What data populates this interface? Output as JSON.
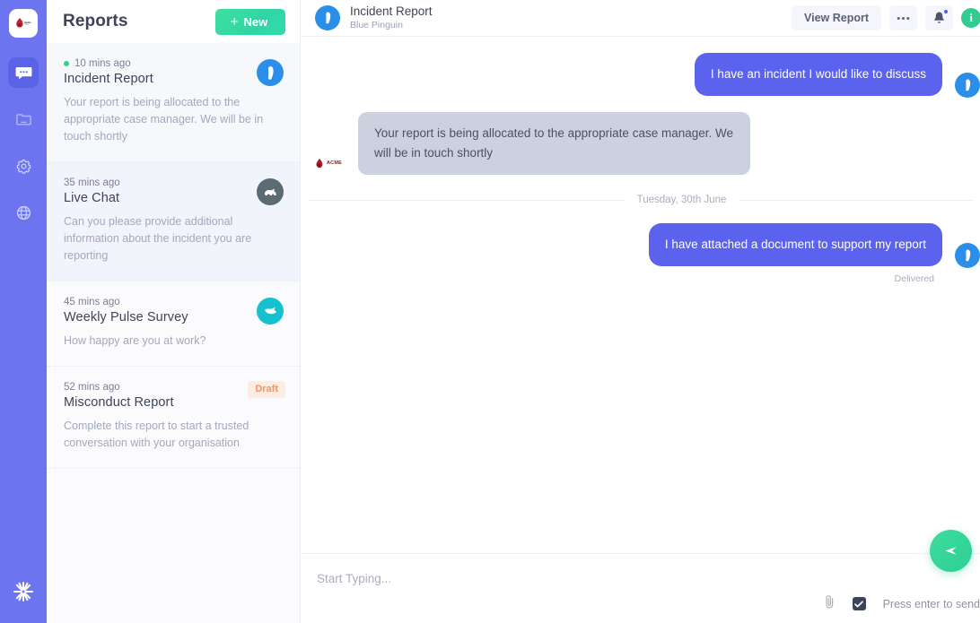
{
  "rail": {
    "logo_alt": "ACME",
    "items": [
      {
        "name": "chat",
        "icon": "chat-bubble-icon",
        "active": true
      },
      {
        "name": "archive",
        "icon": "folder-icon",
        "active": false
      },
      {
        "name": "settings",
        "icon": "gear-icon",
        "active": false
      },
      {
        "name": "globe",
        "icon": "globe-icon",
        "active": false
      }
    ],
    "bottom_icon": "sparkle-burst-icon"
  },
  "list": {
    "title": "Reports",
    "new_button": "New",
    "new_button_plus": "+",
    "conversations": [
      {
        "time": "10 mins ago",
        "title": "Incident Report",
        "snippet": "Your report is being allocated to the appropriate case manager. We will be in touch shortly",
        "avatar": "penguin-avatar",
        "unread_dot": true,
        "badge": null,
        "state": "selected"
      },
      {
        "time": "35 mins ago",
        "title": "Live Chat",
        "snippet": "Can you please provide additional information about the incident you are reporting",
        "avatar": "rhino-avatar",
        "unread_dot": false,
        "badge": null,
        "state": "tinted"
      },
      {
        "time": "45 mins ago",
        "title": "Weekly Pulse Survey",
        "snippet": "How happy are you at work?",
        "avatar": "whale-avatar",
        "unread_dot": false,
        "badge": null,
        "state": "normal"
      },
      {
        "time": "52 mins ago",
        "title": "Misconduct Report",
        "snippet": "Complete this report to start a trusted conversation with your organisation",
        "avatar": null,
        "unread_dot": false,
        "badge": "Draft",
        "state": "normal"
      }
    ]
  },
  "chat": {
    "header": {
      "title": "Incident Report",
      "subtitle": "Blue Pinguin",
      "avatar": "penguin-avatar",
      "view_report": "View Report",
      "more_label": "•••",
      "bell_icon": "bell-icon",
      "info_icon": "info-icon",
      "info_glyph": "i"
    },
    "messages": [
      {
        "direction": "out",
        "text": "I have an incident I would like to discuss",
        "avatar": "penguin-avatar",
        "status": null
      },
      {
        "direction": "in",
        "text": "Your report is being allocated to the appropriate case manager. We will be in touch shortly",
        "avatar": "acme-logo",
        "status": null
      }
    ],
    "divider_label": "Tuesday, 30th June",
    "messages_after": [
      {
        "direction": "out",
        "text": "I have attached a document to support my report",
        "avatar": "penguin-avatar",
        "status": "Delivered"
      }
    ]
  },
  "composer": {
    "placeholder": "Start Typing...",
    "value": "",
    "attach_icon": "paperclip-icon",
    "enter_hint": "Press enter to send",
    "send_icon": "send-icon",
    "checkbox_checked": true
  },
  "colors": {
    "rail": "#6d74f0",
    "accent_green": "#2ecf93",
    "bubble_out": "#5a62ee",
    "bubble_in": "#ccd1e0",
    "penguin_blue": "#2b8fea",
    "rhino_gray": "#5b6a73",
    "whale_teal": "#15c0cf",
    "draft_orange": "#f2956a",
    "status_dot": "#2fd48b"
  }
}
